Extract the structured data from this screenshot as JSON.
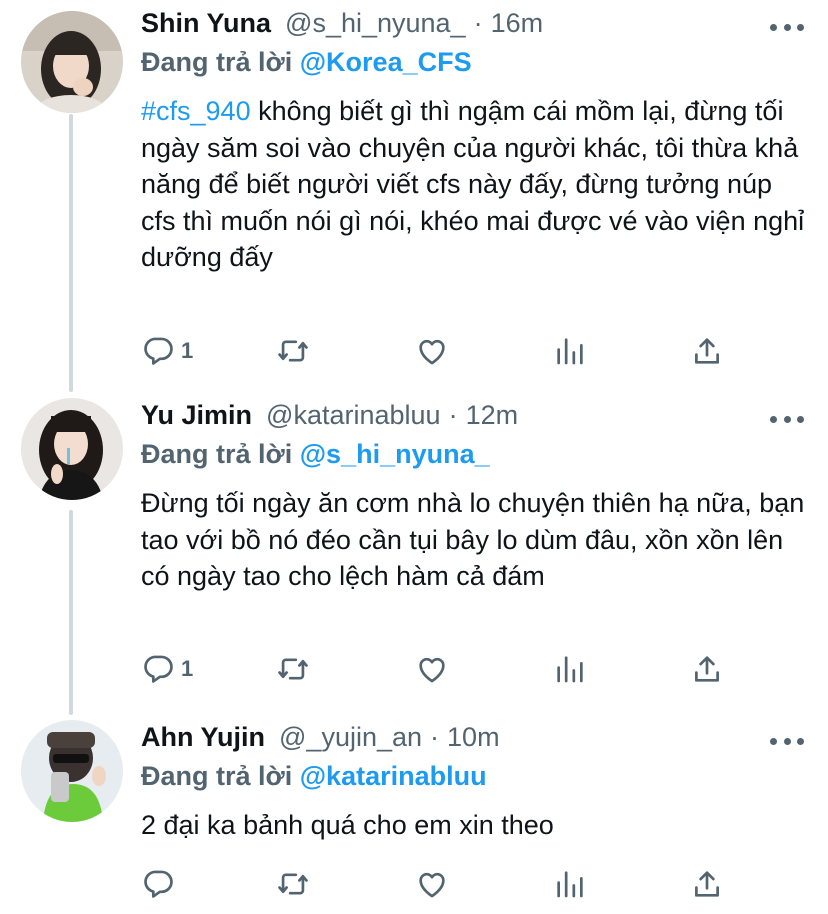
{
  "tweets": [
    {
      "name": "Shin Yuna",
      "handle": "@s_hi_nyuna_",
      "time": "16m",
      "reply_prefix": "Đang trả lời",
      "reply_to": "@Korea_CFS",
      "hashtag": "#cfs_940",
      "text": " không biết gì thì ngậm cái mồm lại, đừng tối ngày săm soi vào chuyện của người khác, tôi thừa khả năng để biết người viết cfs này đấy, đừng tưởng núp cfs thì muốn nói gì nói, khéo mai được vé vào viện nghỉ dưỡng đấy",
      "reply_count": "1",
      "retweet_count": "",
      "like_count": ""
    },
    {
      "name": "Yu Jimin",
      "handle": "@katarinabluu",
      "time": "12m",
      "reply_prefix": "Đang trả lời",
      "reply_to": "@s_hi_nyuna_",
      "text": "Đừng tối ngày ăn cơm nhà lo chuyện thiên hạ nữa, bạn tao với bồ nó đéo cần tụi bây lo dùm đâu, xồn xồn lên có ngày tao cho lệch hàm cả đám",
      "reply_count": "1",
      "retweet_count": "",
      "like_count": ""
    },
    {
      "name": "Ahn Yujin",
      "handle": "@_yujin_an",
      "time": "10m",
      "reply_prefix": "Đang trả lời",
      "reply_to": "@katarinabluu",
      "text": "2 đại ka bảnh quá cho em xin theo",
      "reply_count": "",
      "retweet_count": "",
      "like_count": ""
    }
  ],
  "separator": "·",
  "icons": [
    "reply-icon",
    "retweet-icon",
    "like-icon",
    "analytics-icon",
    "share-icon",
    "more-icon"
  ],
  "colors": {
    "accent": "#1d9bf0",
    "muted": "#536471",
    "text": "#0f1419",
    "thread_line": "#cfd9de"
  }
}
